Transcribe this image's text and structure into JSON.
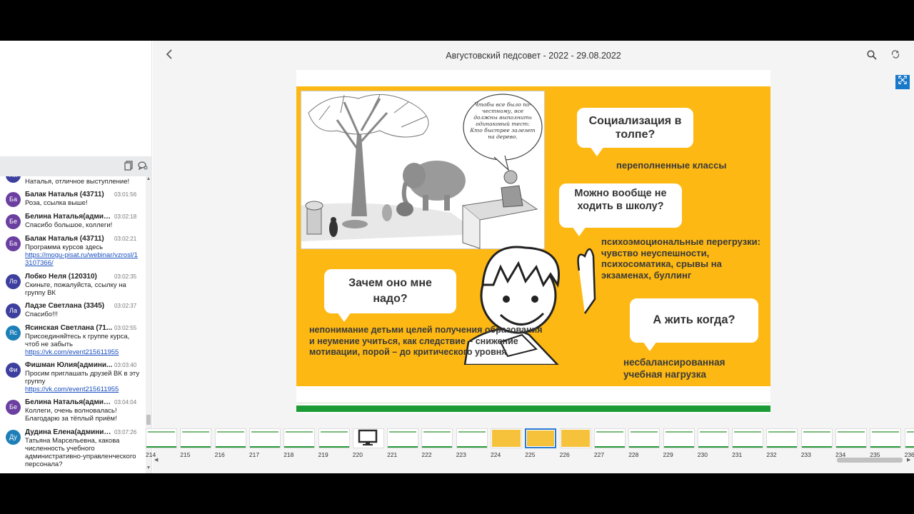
{
  "viewer": {
    "title": "Августовский педсовет - 2022 - 29.08.2022"
  },
  "chat": {
    "messages": [
      {
        "initials": "Ни",
        "color": "#3d3f9e",
        "name": "",
        "time": "",
        "text": "Наталья, отличное выступление!",
        "link": ""
      },
      {
        "initials": "Ба",
        "color": "#6b3fa0",
        "name": "Балак Наталья (43711)",
        "time": "03:01:56",
        "text": "Роза, ссылка выше!",
        "link": ""
      },
      {
        "initials": "Бе",
        "color": "#6b3fa0",
        "name": "Белина Наталья(админ...",
        "time": "03:02:18",
        "text": "Спасибо большое, коллеги!",
        "link": ""
      },
      {
        "initials": "Ба",
        "color": "#6b3fa0",
        "name": "Балак Наталья (43711)",
        "time": "03:02:21",
        "text": "Программа курсов здесь",
        "link": "https://mogu-pisat.ru/webinar/vzrosl/13107366/"
      },
      {
        "initials": "Ло",
        "color": "#3d3f9e",
        "name": "Лобко Неля (120310)",
        "time": "03:02:35",
        "text": "Скиньте, пожалуйста, ссылку на группу ВК",
        "link": ""
      },
      {
        "initials": "Ла",
        "color": "#3d3f9e",
        "name": "Ладзе Светлана (3345)",
        "time": "03:02:37",
        "text": "Спасибо!!!",
        "link": ""
      },
      {
        "initials": "Яс",
        "color": "#1e7fb8",
        "name": "Ясинская Светлана (71...",
        "time": "03:02:55",
        "text": "Присоединяйтесь к группе курса, чтоб не забыть",
        "link": "https://vk.com/event215611955"
      },
      {
        "initials": "Фи",
        "color": "#3d3f9e",
        "name": "Фишман Юлия(админи...",
        "time": "03:03:40",
        "text": "Просим приглашать друзей ВК в эту группу",
        "link": "https://vk.com/event215611955"
      },
      {
        "initials": "Бе",
        "color": "#6b3fa0",
        "name": "Белина Наталья(админ...",
        "time": "03:04:04",
        "text": "Коллеги, очень волновалась! Благодарю за тёплый приём!",
        "link": ""
      },
      {
        "initials": "Ду",
        "color": "#1e7fb8",
        "name": "Дудина Елена(админис...",
        "time": "03:07:26",
        "text": "Татьяна Марсельевна, какова численность учебного административно-управленческого персонала?",
        "link": ""
      }
    ]
  },
  "slide": {
    "cartoon_bubble": "Чтобы все было по-честному, все должны выполнить одинаковый тест: Кто быстрее залезет на дерево.",
    "q1": "Социализация в толпе?",
    "a1": "переполненные классы",
    "q2": "Можно вообще не ходить в школу?",
    "a2": "психоэмоциональные перегрузки: чувство неуспешности, психосоматика, срывы на экзаменах, буллинг",
    "q3": "Зачем оно мне надо?",
    "a3": "непонимание детьми целей получения образования и неумение учиться, как следствие – снижение мотивации, порой – до критического уровня",
    "q4": "А жить когда?",
    "a4": "несбалансированная учебная нагрузка"
  },
  "filmstrip": {
    "active": "225",
    "thumbs": [
      "214",
      "215",
      "216",
      "217",
      "218",
      "219",
      "220",
      "221",
      "222",
      "223",
      "224",
      "225",
      "226",
      "227",
      "228",
      "229",
      "230",
      "231",
      "232",
      "233",
      "234",
      "235",
      "236"
    ]
  },
  "icons": {
    "back": "chevron-left-icon",
    "search": "search-icon",
    "refresh": "refresh-icon",
    "expand": "expand-icon",
    "copy": "copy-icon",
    "chat": "chat-icon"
  }
}
